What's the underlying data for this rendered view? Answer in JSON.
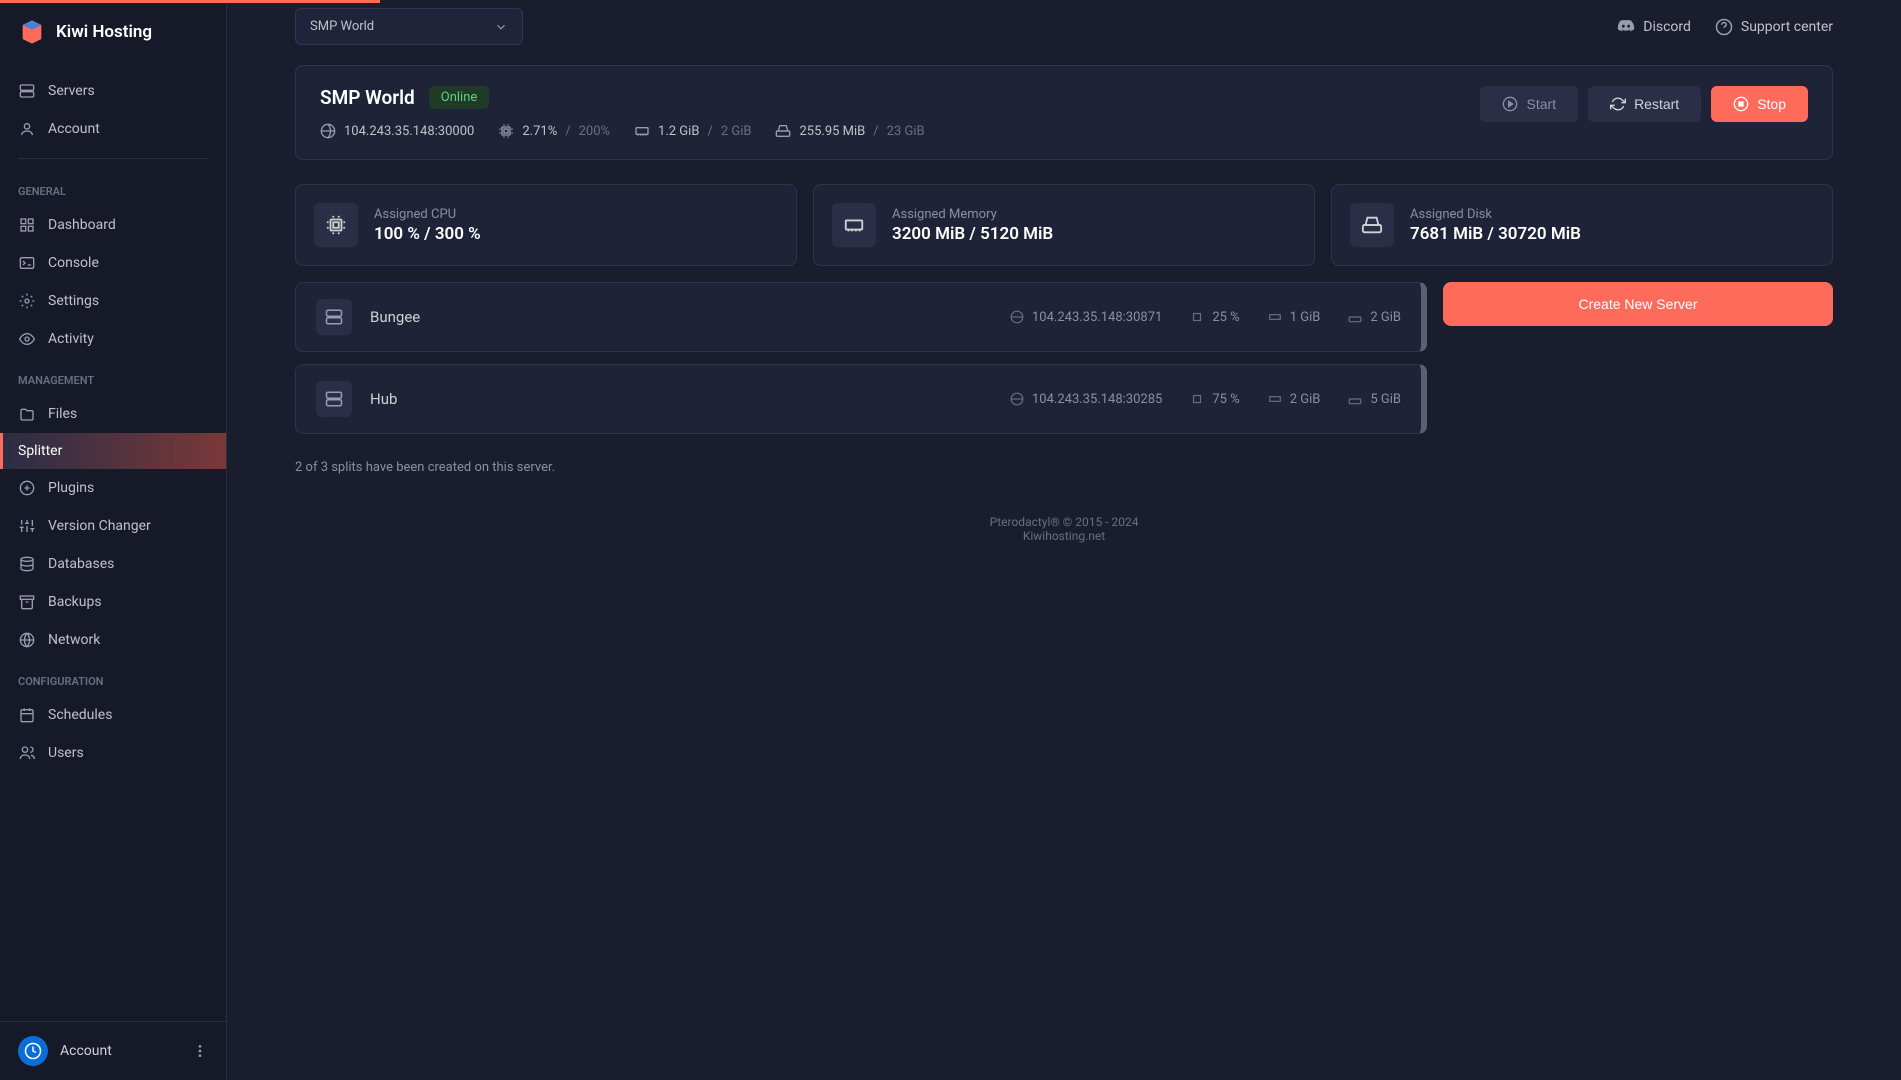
{
  "brand": "Kiwi Hosting",
  "topnav": {
    "servers": "Servers",
    "account": "Account"
  },
  "sections": {
    "general": "GENERAL",
    "management": "MANAGEMENT",
    "configuration": "CONFIGURATION"
  },
  "nav": {
    "dashboard": "Dashboard",
    "console": "Console",
    "settings": "Settings",
    "activity": "Activity",
    "files": "Files",
    "splitter": "Splitter",
    "plugins": "Plugins",
    "version": "Version Changer",
    "databases": "Databases",
    "backups": "Backups",
    "network": "Network",
    "schedules": "Schedules",
    "users": "Users"
  },
  "account_bar": "Account",
  "server_select": "SMP World",
  "topbar": {
    "discord": "Discord",
    "support": "Support center"
  },
  "server": {
    "name": "SMP World",
    "status": "Online",
    "ip": "104.243.35.148:30000",
    "cpu": "2.71%",
    "cpu_max": "200%",
    "memory": "1.2 GiB",
    "memory_max": "2 GiB",
    "disk": "255.95 MiB",
    "disk_max": "23 GiB"
  },
  "actions": {
    "start": "Start",
    "restart": "Restart",
    "stop": "Stop"
  },
  "cards": {
    "cpu": {
      "label": "Assigned CPU",
      "value": "100 % / 300 %"
    },
    "memory": {
      "label": "Assigned Memory",
      "value": "3200 MiB / 5120 MiB"
    },
    "disk": {
      "label": "Assigned Disk",
      "value": "7681 MiB / 30720 MiB"
    }
  },
  "create_button": "Create New Server",
  "splits": [
    {
      "name": "Bungee",
      "ip": "104.243.35.148:30871",
      "cpu": "25 %",
      "mem": "1 GiB",
      "disk": "2 GiB"
    },
    {
      "name": "Hub",
      "ip": "104.243.35.148:30285",
      "cpu": "75 %",
      "mem": "2 GiB",
      "disk": "5 GiB"
    }
  ],
  "splits_count": "2 of 3 splits have been created on this server.",
  "footer": {
    "line1": "Pterodactyl® © 2015 - 2024",
    "line2": "Kiwihosting.net"
  }
}
